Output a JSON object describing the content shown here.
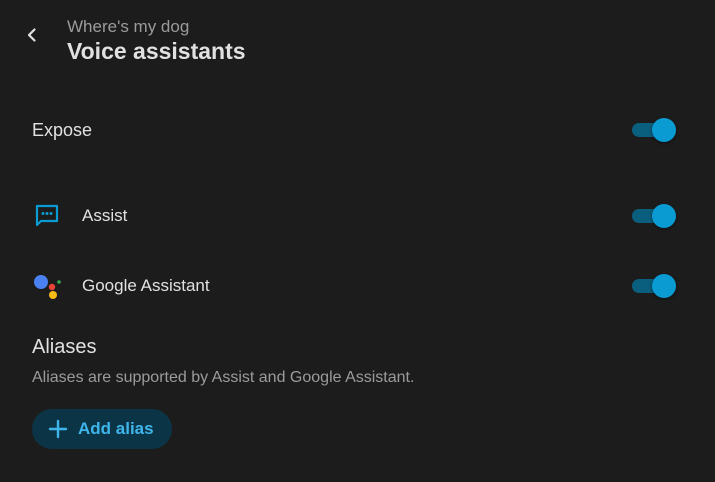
{
  "header": {
    "subtitle": "Where's my dog",
    "title": "Voice assistants"
  },
  "expose": {
    "label": "Expose",
    "enabled": true
  },
  "assistants": [
    {
      "label": "Assist",
      "icon": "chat-bubble-icon",
      "enabled": true
    },
    {
      "label": "Google Assistant",
      "icon": "google-assistant-icon",
      "enabled": true
    }
  ],
  "aliases": {
    "title": "Aliases",
    "description": "Aliases are supported by Assist and Google Assistant.",
    "add_label": "Add alias"
  },
  "colors": {
    "background": "#1c1c1c",
    "accent": "#0a9bd3",
    "accent_track": "#0a5f7e",
    "button_bg": "#0b3546",
    "button_text": "#3fb6eb"
  }
}
